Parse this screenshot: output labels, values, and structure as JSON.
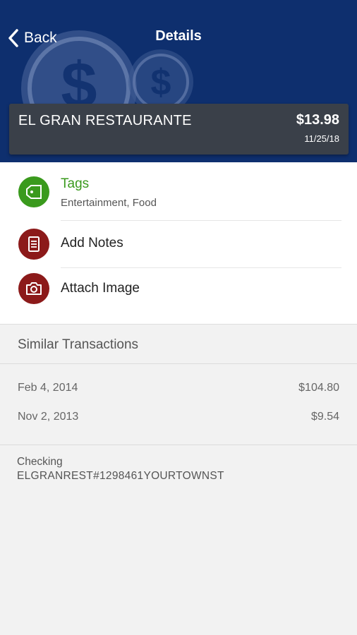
{
  "header": {
    "back_label": "Back",
    "title": "Details",
    "background_color": "#0e2f6e"
  },
  "transaction": {
    "merchant": "EL GRAN RESTAURANTE",
    "amount": "$13.98",
    "date": "11/25/18"
  },
  "actions": {
    "tags": {
      "label": "Tags",
      "value": "Entertainment, Food",
      "icon": "tag-icon",
      "color": "#3a9a1d"
    },
    "notes": {
      "label": "Add Notes",
      "icon": "notes-icon",
      "color": "#8c1a1a"
    },
    "image": {
      "label": "Attach Image",
      "icon": "camera-icon",
      "color": "#8c1a1a"
    }
  },
  "similar": {
    "title": "Similar Transactions",
    "rows": [
      {
        "date": "Feb 4, 2014",
        "amount": "$104.80"
      },
      {
        "date": "Nov 2, 2013",
        "amount": "$9.54"
      }
    ]
  },
  "details": {
    "account": "Checking",
    "descriptor": "ELGRANREST#1298461YOURTOWNST"
  }
}
